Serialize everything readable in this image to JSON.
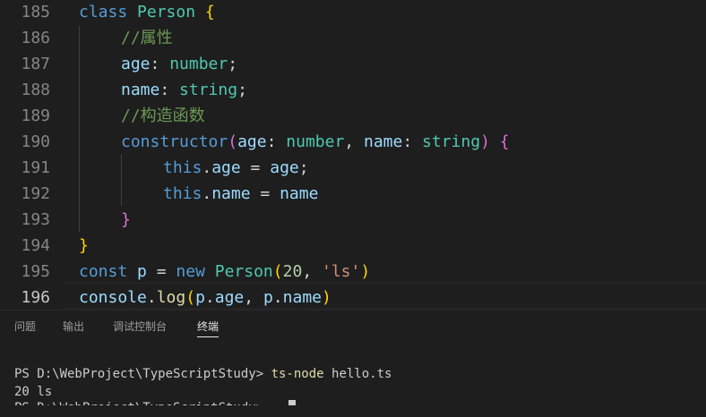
{
  "editor": {
    "lines": [
      {
        "num": "185",
        "tokens": [
          [
            "class ",
            "k"
          ],
          [
            "Person ",
            "t"
          ],
          [
            "{",
            "b1"
          ]
        ]
      },
      {
        "num": "186",
        "tokens": [
          [
            "//属性",
            "c"
          ]
        ]
      },
      {
        "num": "187",
        "tokens": [
          [
            "age",
            "v"
          ],
          [
            ": ",
            "p"
          ],
          [
            "number",
            "t"
          ],
          [
            ";",
            "p"
          ]
        ]
      },
      {
        "num": "188",
        "tokens": [
          [
            "name",
            "v"
          ],
          [
            ": ",
            "p"
          ],
          [
            "string",
            "t"
          ],
          [
            ";",
            "p"
          ]
        ]
      },
      {
        "num": "189",
        "tokens": [
          [
            "//构造函数",
            "c"
          ]
        ]
      },
      {
        "num": "190",
        "tokens": [
          [
            "constructor",
            "k"
          ],
          [
            "(",
            "b2"
          ],
          [
            "age",
            "v"
          ],
          [
            ": ",
            "p"
          ],
          [
            "number",
            "t"
          ],
          [
            ", ",
            "p"
          ],
          [
            "name",
            "v"
          ],
          [
            ": ",
            "p"
          ],
          [
            "string",
            "t"
          ],
          [
            ") ",
            "b2"
          ],
          [
            "{",
            "b2"
          ]
        ]
      },
      {
        "num": "191",
        "tokens": [
          [
            "this",
            "k"
          ],
          [
            ".",
            "p"
          ],
          [
            "age",
            "v"
          ],
          [
            " = ",
            "p"
          ],
          [
            "age",
            "v"
          ],
          [
            ";",
            "p"
          ]
        ]
      },
      {
        "num": "192",
        "tokens": [
          [
            "this",
            "k"
          ],
          [
            ".",
            "p"
          ],
          [
            "name",
            "v"
          ],
          [
            " = ",
            "p"
          ],
          [
            "name",
            "v"
          ]
        ]
      },
      {
        "num": "193",
        "tokens": [
          [
            "}",
            "b2"
          ]
        ]
      },
      {
        "num": "194",
        "tokens": [
          [
            "}",
            "b1"
          ]
        ]
      },
      {
        "num": "195",
        "tokens": [
          [
            "const ",
            "k"
          ],
          [
            "p",
            "v"
          ],
          [
            " = ",
            "p"
          ],
          [
            "new ",
            "k"
          ],
          [
            "Person",
            "t"
          ],
          [
            "(",
            "b1"
          ],
          [
            "20",
            "n"
          ],
          [
            ", ",
            "p"
          ],
          [
            "'ls'",
            "s"
          ],
          [
            ")",
            "b1"
          ]
        ]
      },
      {
        "num": "196",
        "tokens": [
          [
            "console",
            "v"
          ],
          [
            ".",
            "p"
          ],
          [
            "log",
            "f"
          ],
          [
            "(",
            "b1"
          ],
          [
            "p",
            "v"
          ],
          [
            ".",
            "p"
          ],
          [
            "age",
            "v"
          ],
          [
            ", ",
            "p"
          ],
          [
            "p",
            "v"
          ],
          [
            ".",
            "p"
          ],
          [
            "name",
            "v"
          ],
          [
            ")",
            "b1"
          ]
        ]
      }
    ],
    "active_line": "196"
  },
  "panel": {
    "tabs": [
      {
        "label": "问题"
      },
      {
        "label": "输出"
      },
      {
        "label": "调试控制台"
      },
      {
        "label": "终端"
      }
    ],
    "active_tab": "终端",
    "terminal": {
      "prompt": "PS D:\\WebProject\\TypeScriptStudy> ",
      "command": "ts-node",
      "args": " hello.ts",
      "output": "20 ls",
      "partial": "PS D:\\WebProject\\TypeScriptStudy>"
    }
  },
  "colors": {
    "background": "#1e1e1e",
    "keyword": "#569cd6",
    "type": "#4ec9b0",
    "variable": "#9cdcfe",
    "function": "#dcdcaa",
    "comment": "#6a9955",
    "string": "#ce9178",
    "number": "#b5cea8"
  }
}
